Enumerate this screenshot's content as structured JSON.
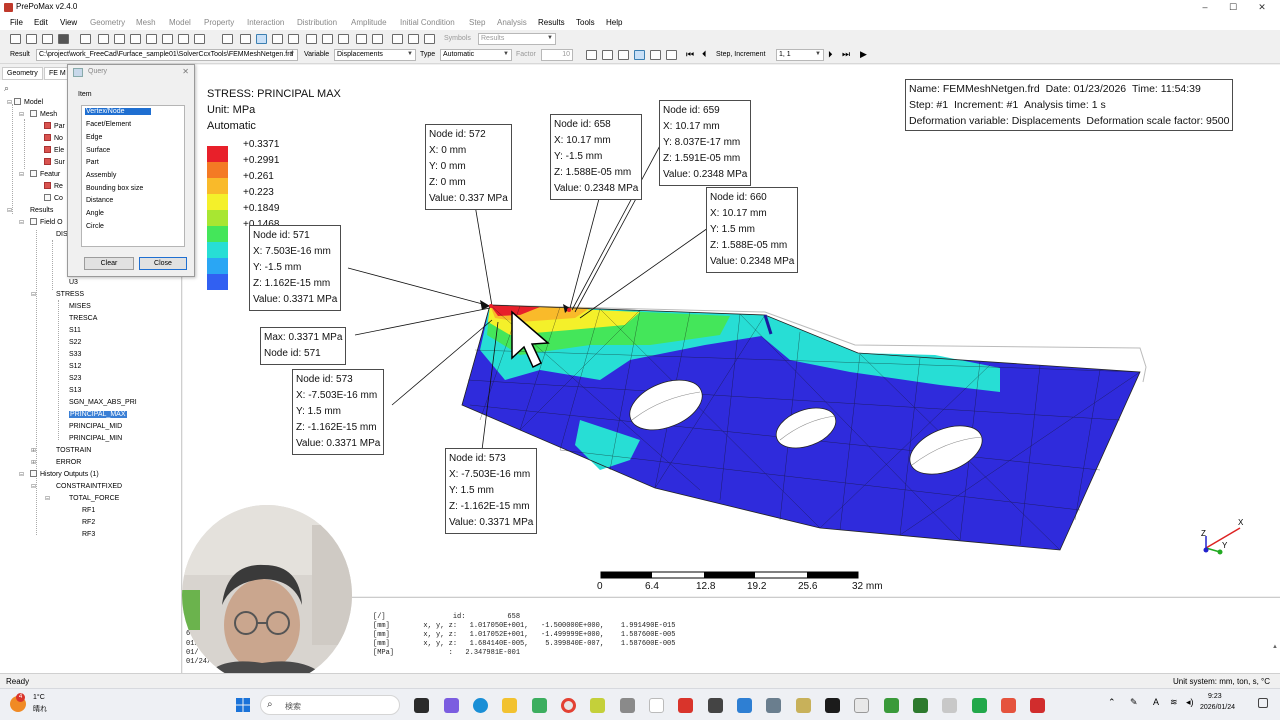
{
  "window": {
    "title": "PrePoMax v2.4.0",
    "controls": [
      "–",
      "☐",
      "✕"
    ]
  },
  "menu": [
    "File",
    "Edit",
    "View",
    "Geometry",
    "Mesh",
    "Model",
    "Property",
    "Interaction",
    "Distribution",
    "Amplitude",
    "Initial Condition",
    "Step",
    "Analysis",
    "Results",
    "Tools",
    "Help"
  ],
  "toolbar": {
    "symbols_label": "Symbols",
    "symbols_value": "Results",
    "result_label": "Result",
    "result_path": "C:\\project\\work_FreeCad\\Furface_sample01\\SolverCcxTools\\FEMMeshNetgen.frd",
    "variable_label": "Variable",
    "variable_value": "Displacements",
    "type_label": "Type",
    "type_value": "Automatic",
    "factor_label": "Factor",
    "factor_value": "10",
    "step_label": "Step, Increment",
    "step_value": "1, 1"
  },
  "left_panel": {
    "tabs": [
      "Geometry",
      "FE M"
    ],
    "search_icon": "search-icon",
    "tree": {
      "model": "Model",
      "mesh": "Mesh",
      "mesh_children": [
        "Par",
        "No",
        "Ele",
        "Sur"
      ],
      "features": "Featur",
      "features_children": [
        "Re",
        "Co"
      ],
      "results": "Results",
      "field_outputs": "Field O",
      "dis": "DIS",
      "u3": "U3",
      "stress": "STRESS",
      "stress_children": [
        "MISES",
        "TRESCA",
        "S11",
        "S22",
        "S33",
        "S12",
        "S23",
        "S13",
        "SGN_MAX_ABS_PRI",
        "PRINCIPAL_MAX",
        "PRINCIPAL_MID",
        "PRINCIPAL_MIN"
      ],
      "selected": "PRINCIPAL_MAX",
      "tostrain": "TOSTRAIN",
      "error": "ERROR",
      "history_outputs": "History Outputs (1)",
      "constraint": "CONSTRAINTFIXED",
      "total_force": "TOTAL_FORCE",
      "rf": [
        "RF1",
        "RF2",
        "RF3"
      ]
    }
  },
  "query_dialog": {
    "title": "Query",
    "group_label": "Item",
    "items": [
      "Vertex/Node",
      "Facet/Element",
      "Edge",
      "Surface",
      "Part",
      "Assembly",
      "Bounding box size",
      "Distance",
      "Angle",
      "Circle"
    ],
    "selected_item": "Vertex/Node",
    "clear_label": "Clear",
    "close_label": "Close"
  },
  "legend": {
    "title": "STRESS: PRINCIPAL MAX",
    "unit": "Unit: MPa",
    "mode": "Automatic",
    "values": [
      "+0.3371",
      "+0.2991",
      "+0.261",
      "+0.223",
      "+0.1849"
    ],
    "hidden_partial": "+0.1468",
    "colors": [
      "#e8202a",
      "#f47a24",
      "#f9ba2a",
      "#f4f02a",
      "#a8e632",
      "#44e65a",
      "#27ded5",
      "#2aa6f4",
      "#3160f2",
      "#2f2bdc"
    ]
  },
  "info_box": {
    "name": "Name: FEMMeshNetgen.frd",
    "date": "Date: 01/23/2026",
    "time": "Time: 11:54:39",
    "step": "Step: #1",
    "increment": "Increment: #1",
    "analysis_time": "Analysis time: 1 s",
    "deformation_variable": "Deformation variable: Displacements",
    "deformation_scale": "Deformation scale factor: 9500"
  },
  "callouts": {
    "n571": [
      "Node id: 571",
      "X: 7.503E-16 mm",
      "Y: -1.5 mm",
      "Z: 1.162E-15 mm",
      "Value: 0.3371 MPa"
    ],
    "n572": [
      "Node id: 572",
      "X: 0 mm",
      "Y: 0 mm",
      "Z: 0 mm",
      "Value: 0.337 MPa"
    ],
    "n658": [
      "Node id: 658",
      "X: 10.17 mm",
      "Y: -1.5 mm",
      "Z: 1.588E-05 mm",
      "Value: 0.2348 MPa"
    ],
    "n659": [
      "Node id: 659",
      "X: 10.17 mm",
      "Y: 8.037E-17 mm",
      "Z: 1.591E-05 mm",
      "Value: 0.2348 MPa"
    ],
    "n660": [
      "Node id: 660",
      "X: 10.17 mm",
      "Y: 1.5 mm",
      "Z: 1.588E-05 mm",
      "Value: 0.2348 MPa"
    ],
    "max": [
      "Max: 0.3371 MPa",
      "Node id: 571"
    ],
    "n573a": [
      "Node id: 573",
      "X: -7.503E-16 mm",
      "Y: 1.5 mm",
      "Z: -1.162E-15 mm",
      "Value: 0.3371 MPa"
    ],
    "n573b": [
      "Node id: 573",
      "X: -7.503E-16 mm",
      "Y: 1.5 mm",
      "Z: -1.162E-15 mm",
      "Value: 0.3371 MPa"
    ]
  },
  "scale_bar": {
    "ticks": [
      "0",
      "6.4",
      "12.8",
      "19.2",
      "25.6",
      "32 mm"
    ]
  },
  "axis_triad": [
    "X",
    "Y",
    "Z"
  ],
  "console": {
    "lines": [
      "[/]                id:          658",
      "[mm]        x, y, z:   1.017050E+001,   -1.500000E+000,    1.991490E-015",
      "[mm]        x, y, z:   1.017052E+001,   -1.499999E+000,    1.587600E-005",
      "[mm]        x, y, z:   1.684140E-005,    5.399840E-007,    1.587600E-005",
      "[MPa]             :   2.347981E-001"
    ],
    "left_fragments": [
      "6",
      "01/",
      "01/",
      "01/24/"
    ]
  },
  "status": {
    "left": "Ready",
    "right": "Unit system: mm, ton, s, °C"
  },
  "taskbar": {
    "weather_temp": "1°C",
    "weather_desc": "晴れ",
    "search_placeholder": "検索",
    "time": "9:23",
    "date": "2026/01/24",
    "badge": "4"
  }
}
